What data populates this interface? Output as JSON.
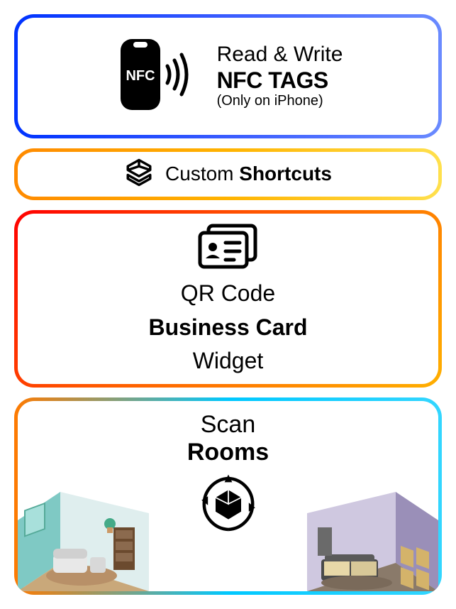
{
  "nfc": {
    "line1": "Read & Write",
    "line2": "NFC TAGS",
    "line3": "(Only on iPhone)",
    "icon_label": "NFC"
  },
  "shortcuts": {
    "prefix": "Custom ",
    "bold": "Shortcuts"
  },
  "qr": {
    "line1": "QR Code",
    "line2": "Business Card",
    "line3": "Widget"
  },
  "rooms": {
    "line1": "Scan",
    "line2": "Rooms"
  }
}
